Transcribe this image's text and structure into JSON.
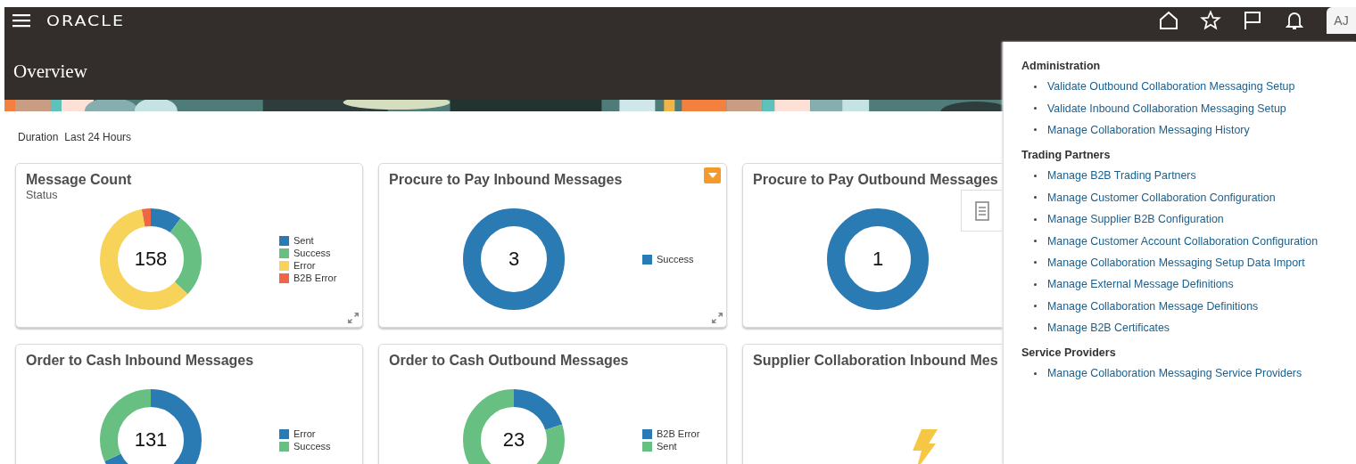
{
  "header": {
    "logo": "ORACLE",
    "title": "Overview",
    "avatar": "AJ"
  },
  "filter": {
    "label": "Duration",
    "value": "Last 24 Hours"
  },
  "cards": [
    {
      "title": "Message Count",
      "subtitle": "Status",
      "kind": "donut",
      "total": "158",
      "menu": false,
      "expandable": true,
      "legend": [
        {
          "label": "Sent",
          "color": "#2a7ab4"
        },
        {
          "label": "Success",
          "color": "#67c081"
        },
        {
          "label": "Error",
          "color": "#f8d35a"
        },
        {
          "label": "B2B Error",
          "color": "#ee6644"
        }
      ]
    },
    {
      "title": "Procure to Pay Inbound Messages",
      "kind": "donut",
      "total": "3",
      "menu": true,
      "expandable": true,
      "legend": [
        {
          "label": "Success",
          "color": "#2a7ab4"
        }
      ]
    },
    {
      "title": "Procure to Pay Outbound Messages",
      "kind": "donut",
      "total": "1"
    },
    {
      "title": "Order to Cash Inbound Messages",
      "kind": "donut",
      "total": "131",
      "menu": false,
      "legend": [
        {
          "label": "Error",
          "color": "#2a7ab4"
        },
        {
          "label": "Success",
          "color": "#67c081"
        }
      ]
    },
    {
      "title": "Order to Cash Outbound Messages",
      "kind": "donut",
      "total": "23",
      "menu": false,
      "legend": [
        {
          "label": "B2B Error",
          "color": "#2a7ab4"
        },
        {
          "label": "Sent",
          "color": "#67c081"
        }
      ]
    },
    {
      "title": "Supplier Collaboration Inbound Mes",
      "kind": "loading"
    }
  ],
  "panel": {
    "sections": [
      {
        "heading": "Administration",
        "links": [
          "Validate Outbound Collaboration Messaging Setup",
          "Validate Inbound Collaboration Messaging Setup",
          "Manage Collaboration Messaging History"
        ]
      },
      {
        "heading": "Trading Partners",
        "links": [
          "Manage B2B Trading Partners",
          "Manage Customer Collaboration Configuration",
          "Manage Supplier B2B Configuration",
          "Manage Customer Account Collaboration Configuration",
          "Manage Collaboration Messaging Setup Data Import",
          "Manage External Message Definitions",
          "Manage Collaboration Message Definitions",
          "Manage B2B Certificates"
        ]
      },
      {
        "heading": "Service Providers",
        "links": [
          "Manage Collaboration Messaging Service Providers"
        ]
      }
    ]
  }
}
